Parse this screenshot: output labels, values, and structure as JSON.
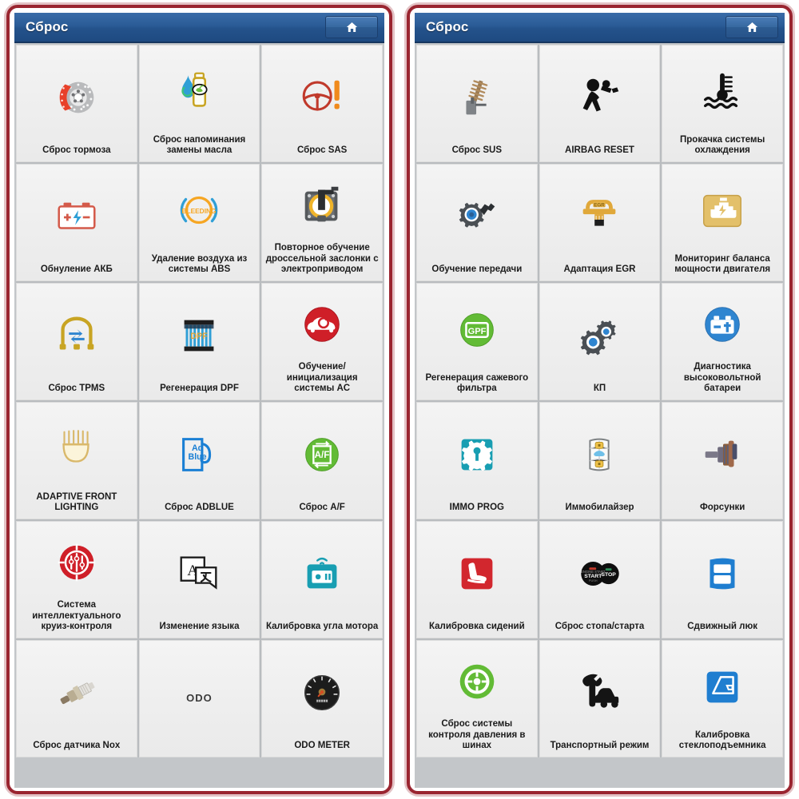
{
  "panels": [
    {
      "header": {
        "title": "Сброс",
        "home_button": "home-icon"
      },
      "tiles": [
        {
          "label": "Сброс тормоза",
          "icon": "brake-disc-icon"
        },
        {
          "label": "Сброс напоминания замены масла",
          "icon": "oil-bottle-icon"
        },
        {
          "label": "Сброс SAS",
          "icon": "steering-wheel-warning-icon"
        },
        {
          "label": "Обнуление АКБ",
          "icon": "battery-icon"
        },
        {
          "label": "Удаление воздуха из системы ABS",
          "icon": "abs-bleeding-icon"
        },
        {
          "label": "Повторное обучение дроссельной заслонки с электроприводом",
          "icon": "throttle-body-icon"
        },
        {
          "label": "Сброс TPMS",
          "icon": "tpms-icon"
        },
        {
          "label": "Регенерация DPF",
          "icon": "dpf-filter-icon"
        },
        {
          "label": "Обучение/ инициализация системы AC",
          "icon": "ac-car-icon"
        },
        {
          "label": "ADAPTIVE FRONT LIGHTING",
          "icon": "headlamp-icon"
        },
        {
          "label": "Сброс ADBLUE",
          "icon": "adblue-icon"
        },
        {
          "label": "Сброс A/F",
          "icon": "af-ratio-icon"
        },
        {
          "label": "Система интеллектуального круиз-контроля",
          "icon": "cruise-control-icon"
        },
        {
          "label": "Изменение языка",
          "icon": "language-switch-icon"
        },
        {
          "label": "Калибровка угла мотора",
          "icon": "motor-angle-icon"
        },
        {
          "label": "Сброс датчика Nox",
          "icon": "nox-sensor-icon"
        },
        {
          "label": "",
          "icon": "odo-text-icon",
          "icon_text": "ODO"
        },
        {
          "label": "ODO METER",
          "icon": "odo-meter-icon"
        }
      ]
    },
    {
      "header": {
        "title": "Сброс",
        "home_button": "home-icon"
      },
      "tiles": [
        {
          "label": "Сброс SUS",
          "icon": "suspension-icon"
        },
        {
          "label": "AIRBAG RESET",
          "icon": "airbag-crash-icon"
        },
        {
          "label": "Прокачка системы охлаждения",
          "icon": "coolant-temp-icon"
        },
        {
          "label": "Обучение передачи",
          "icon": "gear-learning-icon"
        },
        {
          "label": "Адаптация EGR",
          "icon": "egr-valve-icon"
        },
        {
          "label": "Мониторинг баланса мощности двигателя",
          "icon": "engine-power-icon"
        },
        {
          "label": "Регенерация сажевого фильтра",
          "icon": "gpf-icon"
        },
        {
          "label": "КП",
          "icon": "gearbox-cogs-icon"
        },
        {
          "label": "Диагностика высоковольтной батареи",
          "icon": "hv-battery-icon"
        },
        {
          "label": "IMMO PROG",
          "icon": "immo-chip-icon"
        },
        {
          "label": "Иммобилайзер",
          "icon": "immobilizer-key-icon"
        },
        {
          "label": "Форсунки",
          "icon": "injector-icon"
        },
        {
          "label": "Калибровка сидений",
          "icon": "seat-calibration-icon"
        },
        {
          "label": "Сброс стопа/старта",
          "icon": "start-stop-icon"
        },
        {
          "label": "Сдвижный люк",
          "icon": "sunroof-icon"
        },
        {
          "label": "Сброс системы контроля давления в шинах",
          "icon": "tire-pressure-icon"
        },
        {
          "label": "Транспортный режим",
          "icon": "transport-mode-icon"
        },
        {
          "label": "Калибровка стеклоподъемника",
          "icon": "window-regulator-icon"
        }
      ]
    }
  ],
  "colors": {
    "header_blue": "#2a5b96",
    "device_border_red": "#9a2530",
    "tile_bg": "#efefef",
    "grid_bg": "#c3c6c9"
  }
}
